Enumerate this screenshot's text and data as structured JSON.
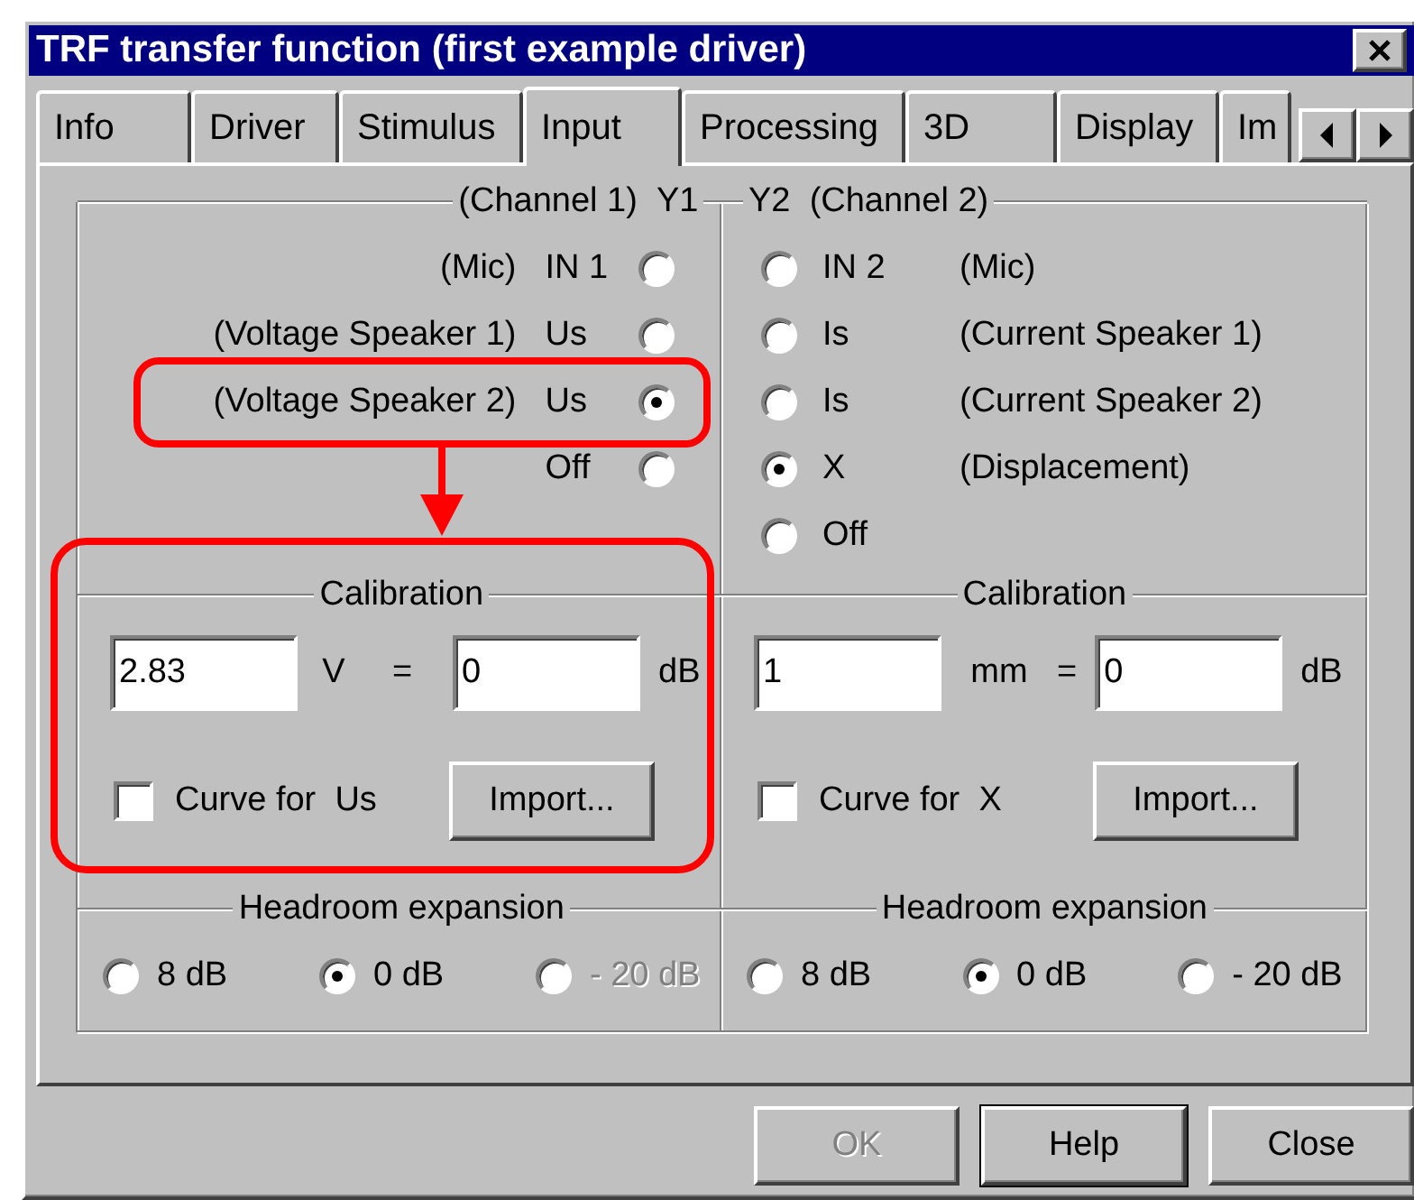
{
  "window": {
    "title": "TRF transfer function (first example driver)"
  },
  "tabs": [
    {
      "label": "Info",
      "selected": false
    },
    {
      "label": "Driver",
      "selected": false
    },
    {
      "label": "Stimulus",
      "selected": false
    },
    {
      "label": "Input",
      "selected": true
    },
    {
      "label": "Processing",
      "selected": false
    },
    {
      "label": "3D",
      "selected": false
    },
    {
      "label": "Display",
      "selected": false
    },
    {
      "label": "Im",
      "selected": false
    }
  ],
  "channels": [
    {
      "header_note": "(Channel 1)",
      "header_code": "Y1",
      "inputs": [
        {
          "note": "(Mic)",
          "code": "IN 1",
          "selected": false
        },
        {
          "note": "(Voltage Speaker 1)",
          "code": "Us",
          "selected": false
        },
        {
          "note": "(Voltage Speaker 2)",
          "code": "Us",
          "selected": true
        },
        {
          "code": "Off",
          "selected": false
        }
      ],
      "calibration": {
        "title": "Calibration",
        "value": "2.83",
        "unit": "V",
        "equals": "=",
        "db_value": "0",
        "db_unit": "dB",
        "curve_label": "Curve for  Us",
        "curve_checked": false,
        "import_button": "Import..."
      },
      "headroom": {
        "title": "Headroom expansion",
        "options": [
          {
            "label": "8 dB",
            "selected": false,
            "disabled": false
          },
          {
            "label": "0 dB",
            "selected": true,
            "disabled": false
          },
          {
            "label": "- 20 dB",
            "selected": false,
            "disabled": true
          }
        ]
      }
    },
    {
      "header_note": "(Channel 2)",
      "header_code": "Y2",
      "inputs": [
        {
          "note": "(Mic)",
          "code": "IN 2",
          "selected": false
        },
        {
          "note": "(Current Speaker 1)",
          "code": "Is",
          "selected": false
        },
        {
          "note": "(Current Speaker 2)",
          "code": "Is",
          "selected": false
        },
        {
          "note": "(Displacement)",
          "code": "X",
          "selected": true
        },
        {
          "code": "Off",
          "selected": false
        }
      ],
      "calibration": {
        "title": "Calibration",
        "value": "1",
        "unit": "mm",
        "equals": "=",
        "db_value": "0",
        "db_unit": "dB",
        "curve_label": "Curve for  X",
        "curve_checked": false,
        "import_button": "Import..."
      },
      "headroom": {
        "title": "Headroom expansion",
        "options": [
          {
            "label": "8 dB",
            "selected": false,
            "disabled": false
          },
          {
            "label": "0 dB",
            "selected": true,
            "disabled": false
          },
          {
            "label": "- 20 dB",
            "selected": false,
            "disabled": false
          }
        ]
      }
    }
  ],
  "buttons": [
    {
      "label": "OK",
      "disabled": true,
      "default": false
    },
    {
      "label": "Help",
      "disabled": false,
      "default": true
    },
    {
      "label": "Close",
      "disabled": false,
      "default": false
    }
  ]
}
